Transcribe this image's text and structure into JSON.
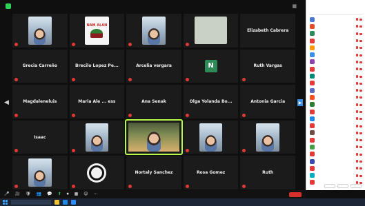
{
  "topbar": {
    "view_label": ""
  },
  "gallery": {
    "tiles": [
      {
        "name": "",
        "kind": "video",
        "caption": ""
      },
      {
        "name": "",
        "kind": "logo",
        "caption": "",
        "logo_text": "NAM ALAN"
      },
      {
        "name": "",
        "kind": "video",
        "caption": ""
      },
      {
        "name": "",
        "kind": "blank-video",
        "caption": ""
      },
      {
        "name": "Elizabeth Cabrera",
        "kind": "name"
      },
      {
        "name": "Grecia Carreño",
        "kind": "name"
      },
      {
        "name": "Brecilo Lopez Pe...",
        "kind": "name"
      },
      {
        "name": "Arcelia vergara",
        "kind": "name"
      },
      {
        "name": "",
        "kind": "avatar",
        "avatar_letter": "N"
      },
      {
        "name": "Ruth Vargas",
        "kind": "name"
      },
      {
        "name": "Magdaleneluis",
        "kind": "name"
      },
      {
        "name": "Maria Ale ... ess",
        "kind": "name"
      },
      {
        "name": "Ana Senak",
        "kind": "name"
      },
      {
        "name": "Olga Yolanda Bo...",
        "kind": "name"
      },
      {
        "name": "Antonia Garcia",
        "kind": "name"
      },
      {
        "name": "Isaac",
        "kind": "name"
      },
      {
        "name": "",
        "kind": "video"
      },
      {
        "name": "",
        "kind": "active-video"
      },
      {
        "name": "",
        "kind": "video"
      },
      {
        "name": "",
        "kind": "video"
      },
      {
        "name": "",
        "kind": "video"
      },
      {
        "name": "",
        "kind": "badge"
      },
      {
        "name": "Nortaly Sanchez",
        "kind": "name"
      },
      {
        "name": "Rosa Gomez",
        "kind": "name"
      },
      {
        "name": "Ruth",
        "kind": "name"
      }
    ]
  },
  "participants": {
    "title": "",
    "avatar_colors": [
      "#4a7bd0",
      "#e44d26",
      "#2e8b57",
      "#e53935",
      "#ff9800",
      "#3a8ee6",
      "#8e44ad",
      "#e53935",
      "#00897b",
      "#e53935",
      "#5c6bc0",
      "#f4511e",
      "#2e7d32",
      "#e53935",
      "#1e88e5",
      "#e53935",
      "#6d4c41",
      "#e53935",
      "#43a047",
      "#e53935",
      "#3949ab",
      "#e53935",
      "#00acc1",
      "#e53935"
    ]
  },
  "controls": {
    "items": [
      {
        "icon": "🎤",
        "label": ""
      },
      {
        "icon": "🎥",
        "label": ""
      },
      {
        "icon": "🛡",
        "label": ""
      },
      {
        "icon": "👥",
        "label": ""
      },
      {
        "icon": "💬",
        "label": ""
      },
      {
        "icon": "⬆",
        "label": "",
        "accent": true
      },
      {
        "icon": "⏺",
        "label": ""
      },
      {
        "icon": "▦",
        "label": ""
      },
      {
        "icon": "☺",
        "label": ""
      },
      {
        "icon": "⋯",
        "label": ""
      }
    ]
  },
  "taskbar": {
    "search_placeholder": "",
    "tray_text": ""
  }
}
